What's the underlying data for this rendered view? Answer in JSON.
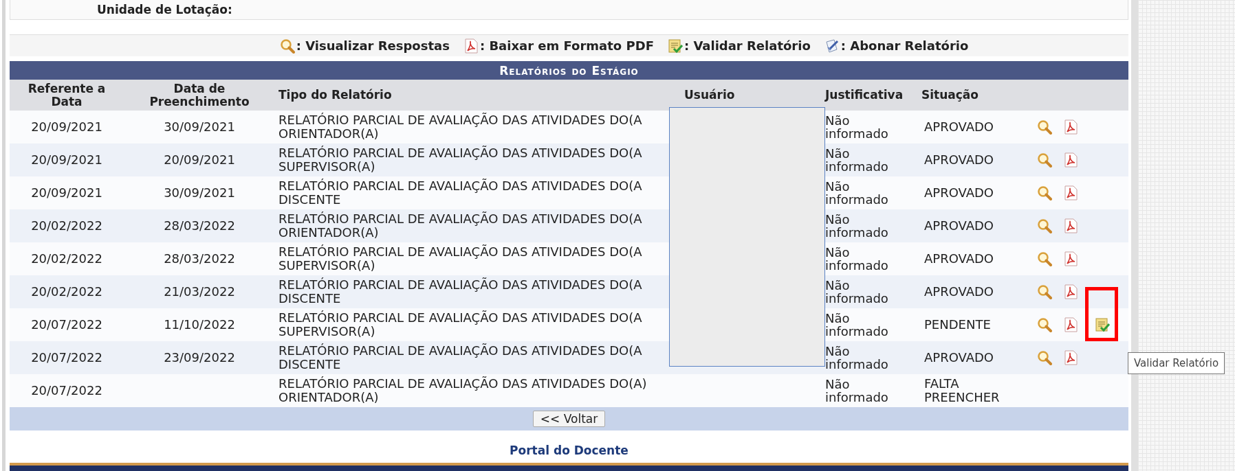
{
  "header_box": {
    "label": "Unidade de Lotação:"
  },
  "legend": [
    {
      "kind": "view",
      "label": ": Visualizar Respostas"
    },
    {
      "kind": "pdf",
      "label": ": Baixar em Formato PDF"
    },
    {
      "kind": "validate",
      "label": ": Validar Relatório"
    },
    {
      "kind": "waive",
      "label": ": Abonar Relatório"
    }
  ],
  "table": {
    "title": "Relatórios do Estágio",
    "columns": [
      "Referente a Data",
      "Data de Preenchimento",
      "Tipo do Relatório",
      "Usuário",
      "Justificativa",
      "Situação"
    ],
    "rows": [
      {
        "reference_date": "20/09/2021",
        "filled_date": "30/09/2021",
        "type": [
          "RELATÓRIO PARCIAL DE AVALIAÇÃO DAS ATIVIDADES DO(A",
          "ORIENTADOR(A)"
        ],
        "justification": "Não informado",
        "status": "APROVADO",
        "actions": [
          {
            "kind": "view"
          },
          {
            "kind": "pdf"
          }
        ]
      },
      {
        "reference_date": "20/09/2021",
        "filled_date": "20/09/2021",
        "type": [
          "RELATÓRIO PARCIAL DE AVALIAÇÃO DAS ATIVIDADES DO(A",
          "SUPERVISOR(A)"
        ],
        "justification": "Não informado",
        "status": "APROVADO",
        "actions": [
          {
            "kind": "view"
          },
          {
            "kind": "pdf"
          }
        ]
      },
      {
        "reference_date": "20/09/2021",
        "filled_date": "30/09/2021",
        "type": [
          "RELATÓRIO PARCIAL DE AVALIAÇÃO DAS ATIVIDADES DO(A",
          "DISCENTE"
        ],
        "justification": "Não informado",
        "status": "APROVADO",
        "actions": [
          {
            "kind": "view"
          },
          {
            "kind": "pdf"
          }
        ]
      },
      {
        "reference_date": "20/02/2022",
        "filled_date": "28/03/2022",
        "type": [
          "RELATÓRIO PARCIAL DE AVALIAÇÃO DAS ATIVIDADES DO(A",
          "ORIENTADOR(A)"
        ],
        "justification": "Não informado",
        "status": "APROVADO",
        "actions": [
          {
            "kind": "view"
          },
          {
            "kind": "pdf"
          }
        ]
      },
      {
        "reference_date": "20/02/2022",
        "filled_date": "28/03/2022",
        "type": [
          "RELATÓRIO PARCIAL DE AVALIAÇÃO DAS ATIVIDADES DO(A",
          "SUPERVISOR(A)"
        ],
        "justification": "Não informado",
        "status": "APROVADO",
        "actions": [
          {
            "kind": "view"
          },
          {
            "kind": "pdf"
          }
        ]
      },
      {
        "reference_date": "20/02/2022",
        "filled_date": "21/03/2022",
        "type": [
          "RELATÓRIO PARCIAL DE AVALIAÇÃO DAS ATIVIDADES DO(A",
          "DISCENTE"
        ],
        "justification": "Não informado",
        "status": "APROVADO",
        "actions": [
          {
            "kind": "view"
          },
          {
            "kind": "pdf"
          }
        ]
      },
      {
        "reference_date": "20/07/2022",
        "filled_date": "11/10/2022",
        "type": [
          "RELATÓRIO PARCIAL DE AVALIAÇÃO DAS ATIVIDADES DO(A",
          "SUPERVISOR(A)"
        ],
        "justification": "Não informado",
        "status": "PENDENTE",
        "actions": [
          {
            "kind": "view"
          },
          {
            "kind": "pdf"
          },
          {
            "kind": "validate",
            "highlighted": true
          }
        ]
      },
      {
        "reference_date": "20/07/2022",
        "filled_date": "23/09/2022",
        "type": [
          "RELATÓRIO PARCIAL DE AVALIAÇÃO DAS ATIVIDADES DO(A",
          "DISCENTE"
        ],
        "justification": "Não informado",
        "status": "APROVADO",
        "actions": [
          {
            "kind": "view"
          },
          {
            "kind": "pdf"
          }
        ]
      },
      {
        "reference_date": "20/07/2022",
        "type": [
          "RELATÓRIO PARCIAL DE AVALIAÇÃO DAS ATIVIDADES DO(A)",
          "ORIENTADOR(A)"
        ],
        "justification": "Não informado",
        "status": "FALTA PREENCHER"
      }
    ],
    "back_button": "<< Voltar"
  },
  "tooltip": "Validar Relatório",
  "footer": {
    "link": "Portal do Docente"
  }
}
